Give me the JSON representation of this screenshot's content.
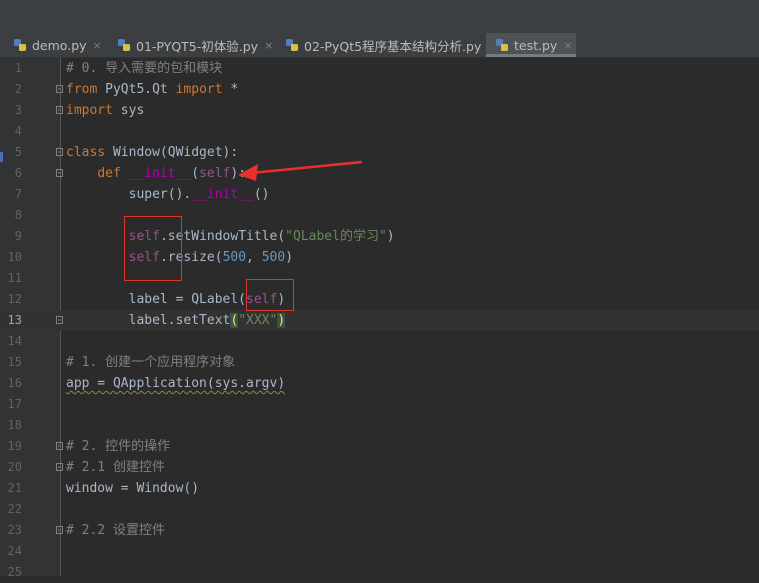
{
  "tabs": [
    {
      "label": "demo.py",
      "active": false
    },
    {
      "label": "01-PYQT5-初体验.py",
      "active": false
    },
    {
      "label": "02-PyQt5程序基本结构分析.py",
      "active": false
    },
    {
      "label": "test.py",
      "active": true
    }
  ],
  "tab_close_glyph": "×",
  "current_line": 13,
  "lines": [
    {
      "n": "1",
      "t": [
        {
          "c": "cmt",
          "v": "# 0. 导入需要的包和模块"
        }
      ]
    },
    {
      "n": "2",
      "t": [
        {
          "c": "kw",
          "v": "from"
        },
        {
          "c": "",
          "v": " PyQt5.Qt "
        },
        {
          "c": "kw",
          "v": "import"
        },
        {
          "c": "",
          "v": " *"
        }
      ]
    },
    {
      "n": "3",
      "t": [
        {
          "c": "kw",
          "v": "import"
        },
        {
          "c": "",
          "v": " sys"
        }
      ]
    },
    {
      "n": "4",
      "t": []
    },
    {
      "n": "5",
      "t": [
        {
          "c": "kw",
          "v": "class"
        },
        {
          "c": "",
          "v": " Window(QWidget):"
        }
      ]
    },
    {
      "n": "6",
      "t": [
        {
          "c": "",
          "v": "    "
        },
        {
          "c": "kw",
          "v": "def"
        },
        {
          "c": "",
          "v": " "
        },
        {
          "c": "dund",
          "v": "__init__"
        },
        {
          "c": "",
          "v": "("
        },
        {
          "c": "slf",
          "v": "self"
        },
        {
          "c": "",
          "v": "):"
        }
      ]
    },
    {
      "n": "7",
      "t": [
        {
          "c": "",
          "v": "        super()."
        },
        {
          "c": "dund",
          "v": "__init__"
        },
        {
          "c": "",
          "v": "()"
        }
      ]
    },
    {
      "n": "8",
      "t": []
    },
    {
      "n": "9",
      "t": [
        {
          "c": "",
          "v": "        "
        },
        {
          "c": "slf",
          "v": "self"
        },
        {
          "c": "",
          "v": ".setWindowTitle("
        },
        {
          "c": "str",
          "v": "\"QLabel的学习\""
        },
        {
          "c": "",
          "v": ")"
        }
      ]
    },
    {
      "n": "10",
      "t": [
        {
          "c": "",
          "v": "        "
        },
        {
          "c": "slf",
          "v": "self"
        },
        {
          "c": "",
          "v": ".resize("
        },
        {
          "c": "num",
          "v": "500"
        },
        {
          "c": "",
          "v": ", "
        },
        {
          "c": "num",
          "v": "500"
        },
        {
          "c": "",
          "v": ")"
        }
      ]
    },
    {
      "n": "11",
      "t": []
    },
    {
      "n": "12",
      "t": [
        {
          "c": "",
          "v": "        label = QLabel("
        },
        {
          "c": "slf",
          "v": "self"
        },
        {
          "c": "",
          "v": ")"
        }
      ]
    },
    {
      "n": "13",
      "t": [
        {
          "c": "",
          "v": "        label.setText"
        },
        {
          "c": "brk",
          "v": "("
        },
        {
          "c": "str",
          "v": "\"XXX\""
        },
        {
          "c": "brk",
          "v": ")"
        }
      ]
    },
    {
      "n": "14",
      "t": []
    },
    {
      "n": "15",
      "t": [
        {
          "c": "cmt",
          "v": "# 1. 创建一个应用程序对象"
        }
      ]
    },
    {
      "n": "16",
      "t": [
        {
          "c": "wavy",
          "v": "app = QApplication(sys.argv)"
        }
      ]
    },
    {
      "n": "17",
      "t": []
    },
    {
      "n": "18",
      "t": []
    },
    {
      "n": "19",
      "t": [
        {
          "c": "cmt",
          "v": "# 2. 控件的操作"
        }
      ]
    },
    {
      "n": "20",
      "t": [
        {
          "c": "cmt",
          "v": "# 2.1 创建控件"
        }
      ]
    },
    {
      "n": "21",
      "t": [
        {
          "c": "",
          "v": "window = Window()"
        }
      ]
    },
    {
      "n": "22",
      "t": []
    },
    {
      "n": "23",
      "t": [
        {
          "c": "cmt",
          "v": "# 2.2 设置控件"
        }
      ]
    },
    {
      "n": "24",
      "t": []
    },
    {
      "n": "25",
      "t": []
    }
  ],
  "fold_lines": [
    2,
    3,
    5,
    6,
    13,
    19,
    20,
    23
  ]
}
